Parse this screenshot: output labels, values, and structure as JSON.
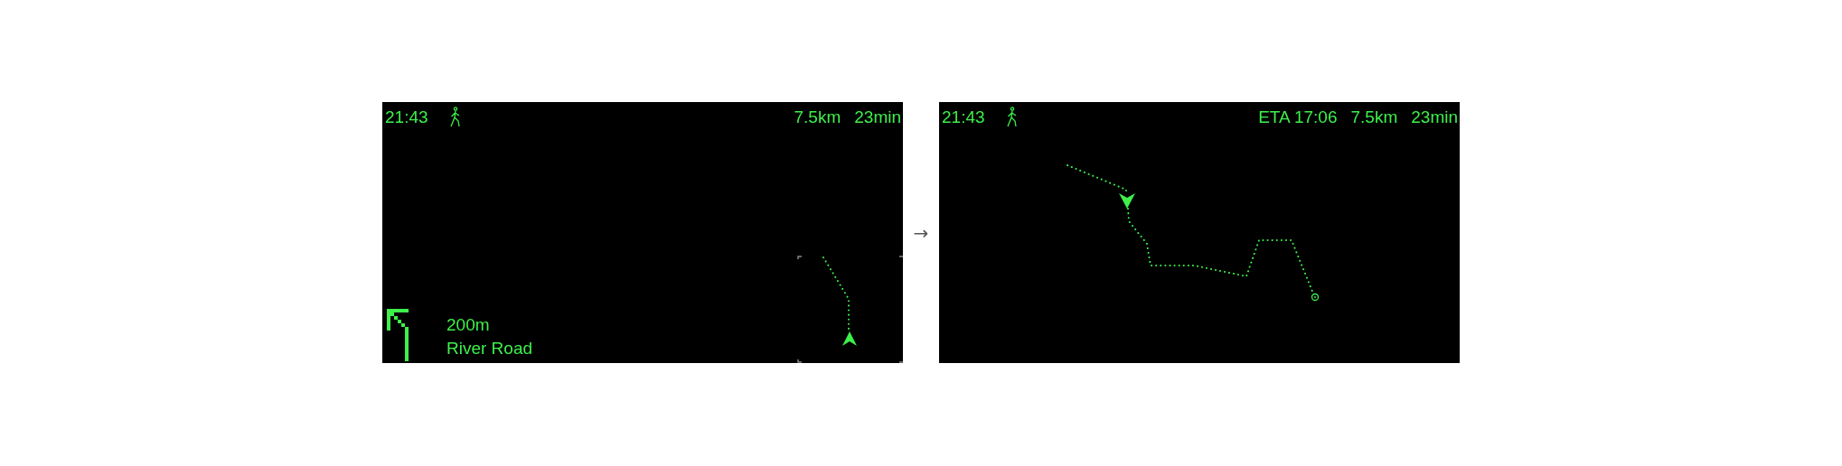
{
  "screens": [
    {
      "kind": "guidance",
      "time": "21:43",
      "stats": [
        "7.5km",
        "23min"
      ],
      "instruction": {
        "distance": "200m",
        "street": "River Road"
      }
    },
    {
      "kind": "overview",
      "time": "21:43",
      "stats": [
        "ETA 17:06",
        "7.5km",
        "23min"
      ]
    }
  ],
  "separator": "→"
}
